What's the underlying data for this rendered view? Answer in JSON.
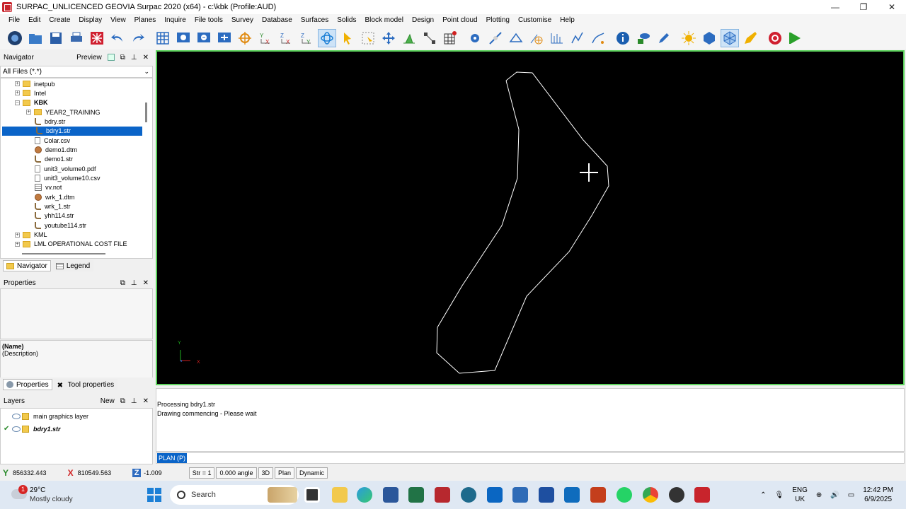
{
  "window": {
    "title": "SURPAC_UNLICENCED GEOVIA Surpac 2020 (x64) - c:\\kbk (Profile:AUD)",
    "minimize": "—",
    "maximize": "❐",
    "close": "✕"
  },
  "menu": [
    "File",
    "Edit",
    "Create",
    "Display",
    "View",
    "Planes",
    "Inquire",
    "File tools",
    "Survey",
    "Database",
    "Surfaces",
    "Solids",
    "Block model",
    "Design",
    "Point cloud",
    "Plotting",
    "Customise",
    "Help"
  ],
  "navigator": {
    "title": "Navigator",
    "preview": "Preview",
    "filter": "All Files (*.*)",
    "tree": [
      {
        "label": "inetpub",
        "type": "folder",
        "level": 1,
        "expander": "+"
      },
      {
        "label": "Intel",
        "type": "folder",
        "level": 1,
        "expander": "+"
      },
      {
        "label": "KBK",
        "type": "folder-open",
        "level": 1,
        "expander": "−",
        "bold": true
      },
      {
        "label": "YEAR2_TRAINING",
        "type": "folder",
        "level": 2,
        "expander": "+"
      },
      {
        "label": "bdry.str",
        "type": "str",
        "level": 2
      },
      {
        "label": "bdry1.str",
        "type": "str",
        "level": 2,
        "selected": true
      },
      {
        "label": "Colar.csv",
        "type": "doc",
        "level": 2
      },
      {
        "label": "demo1.dtm",
        "type": "dtm",
        "level": 2
      },
      {
        "label": "demo1.str",
        "type": "str",
        "level": 2
      },
      {
        "label": "unit3_volume0.pdf",
        "type": "doc",
        "level": 2
      },
      {
        "label": "unit3_volume10.csv",
        "type": "doc",
        "level": 2
      },
      {
        "label": "vv.not",
        "type": "not",
        "level": 2
      },
      {
        "label": "wrk_1.dtm",
        "type": "dtm",
        "level": 2
      },
      {
        "label": "wrk_1.str",
        "type": "str",
        "level": 2
      },
      {
        "label": "yhh114.str",
        "type": "str",
        "level": 2
      },
      {
        "label": "youtube114.str",
        "type": "str",
        "level": 2
      },
      {
        "label": "KML",
        "type": "folder",
        "level": 1,
        "expander": "+"
      },
      {
        "label": "LML OPERATIONAL COST FILE",
        "type": "folder",
        "level": 1,
        "expander": "+"
      }
    ],
    "tabs": [
      "Navigator",
      "Legend"
    ]
  },
  "properties": {
    "title": "Properties",
    "name": "(Name)",
    "description": "(Description)",
    "tabs": [
      "Properties",
      "Tool properties"
    ]
  },
  "layers": {
    "title": "Layers",
    "new": "New",
    "items": [
      {
        "label": "main graphics layer",
        "checked": false
      },
      {
        "label": "bdry1.str",
        "checked": true,
        "active": true
      }
    ]
  },
  "viewport": {
    "axis_y": "Y",
    "axis_x": "X"
  },
  "messages": [
    "Processing bdry1.str",
    "Drawing commencing - Please wait"
  ],
  "command": "PLAN (P)",
  "status": {
    "y_label": "Y",
    "y_value": "856332.443",
    "x_label": "X",
    "x_value": "810549.563",
    "z_label": "Z",
    "z_value": "-1.009",
    "str": "Str = 1",
    "angle": "0.000 angle",
    "mode3d": "3D",
    "plan": "Plan",
    "dynamic": "Dynamic"
  },
  "taskbar": {
    "weather_badge": "1",
    "temperature": "29°C",
    "condition": "Mostly cloudy",
    "search": "Search",
    "lang1": "ENG",
    "lang2": "UK",
    "time": "12:42 PM",
    "date": "6/9/2025"
  },
  "colors": {
    "viewport_bg": "#000000",
    "viewport_border": "#5dd35d",
    "selection": "#0a64c8",
    "boundary": "#ffffff"
  }
}
